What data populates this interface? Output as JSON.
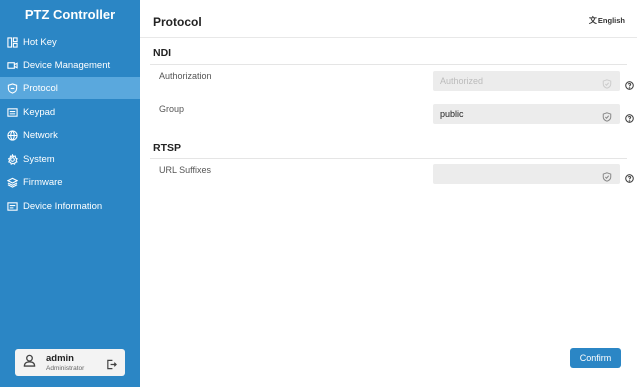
{
  "app": {
    "title": "PTZ Controller"
  },
  "sidebar": {
    "items": [
      {
        "label": "Hot Key",
        "icon": "hotkey-icon"
      },
      {
        "label": "Device Management",
        "icon": "camera-icon"
      },
      {
        "label": "Protocol",
        "icon": "shield-icon",
        "active": true
      },
      {
        "label": "Keypad",
        "icon": "keyboard-icon"
      },
      {
        "label": "Network",
        "icon": "globe-icon"
      },
      {
        "label": "System",
        "icon": "gear-icon"
      },
      {
        "label": "Firmware",
        "icon": "layers-icon"
      },
      {
        "label": "Device Information",
        "icon": "info-card-icon"
      }
    ],
    "user": {
      "name": "admin",
      "role": "Administrator"
    }
  },
  "header": {
    "title": "Protocol",
    "language": "English"
  },
  "sections": {
    "ndi": {
      "title": "NDI",
      "authorization": {
        "label": "Authorization",
        "value": "Authorized"
      },
      "group": {
        "label": "Group",
        "value": "public"
      }
    },
    "rtsp": {
      "title": "RTSP",
      "url_suffixes": {
        "label": "URL Suffixes",
        "value": ""
      }
    }
  },
  "actions": {
    "confirm_label": "Confirm"
  },
  "colors": {
    "sidebar_bg": "#2b86c5",
    "sidebar_active": "#5aa8dd",
    "field_bg": "#ececec"
  }
}
